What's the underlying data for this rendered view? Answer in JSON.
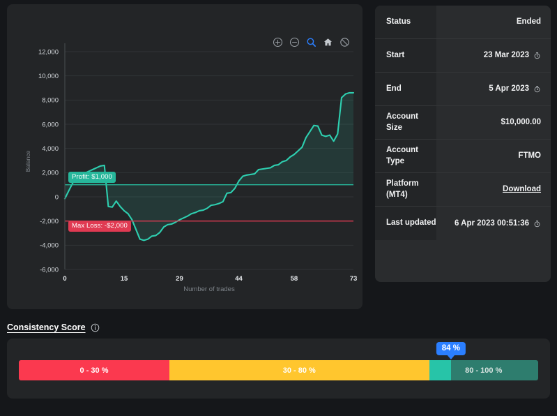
{
  "chart_data": {
    "type": "line",
    "title": "",
    "xlabel": "Number of trades",
    "ylabel": "Balance",
    "xlim": [
      0,
      73
    ],
    "ylim": [
      -6000,
      12000
    ],
    "xticks": [
      0,
      15,
      29,
      44,
      58,
      73
    ],
    "yticks": [
      -6000,
      -4000,
      -2000,
      0,
      2000,
      4000,
      6000,
      8000,
      10000,
      12000
    ],
    "ytick_labels": [
      "-6,000",
      "-4,000",
      "-2,000",
      "0",
      "2,000",
      "4,000",
      "6,000",
      "8,000",
      "10,000",
      "12,000"
    ],
    "grid": true,
    "legend": "none",
    "series": [
      {
        "name": "Balance",
        "color": "#2ecfb0",
        "fill": true,
        "x": [
          0,
          1,
          2,
          3,
          4,
          5,
          6,
          7,
          8,
          9,
          10,
          11,
          12,
          13,
          14,
          15,
          16,
          17,
          18,
          19,
          20,
          21,
          22,
          23,
          24,
          25,
          26,
          27,
          28,
          29,
          30,
          31,
          32,
          33,
          34,
          35,
          36,
          37,
          38,
          39,
          40,
          41,
          42,
          43,
          44,
          45,
          46,
          47,
          48,
          49,
          50,
          51,
          52,
          53,
          54,
          55,
          56,
          57,
          58,
          59,
          60,
          61,
          62,
          63,
          64,
          65,
          66,
          67,
          68,
          69,
          70,
          71,
          72,
          73
        ],
        "y": [
          -150,
          500,
          1150,
          1500,
          1750,
          1950,
          2100,
          2250,
          2400,
          2550,
          2600,
          -800,
          -850,
          -350,
          -800,
          -1150,
          -1400,
          -1900,
          -2700,
          -3500,
          -3600,
          -3500,
          -3250,
          -3200,
          -2950,
          -2500,
          -2300,
          -2250,
          -2100,
          -1900,
          -1750,
          -1600,
          -1400,
          -1300,
          -1150,
          -1100,
          -950,
          -700,
          -650,
          -550,
          -400,
          300,
          350,
          700,
          1300,
          1700,
          1800,
          1850,
          1900,
          2250,
          2300,
          2350,
          2400,
          2600,
          2650,
          2900,
          3000,
          3300,
          3500,
          3800,
          4100,
          4900,
          5400,
          5900,
          5850,
          5100,
          5000,
          5100,
          4600,
          5200,
          8200,
          8500,
          8600,
          8600
        ]
      }
    ],
    "reference_lines": [
      {
        "name": "profit-target",
        "value": 1000,
        "color": "#27b79b",
        "label": "Profit: $1,000"
      },
      {
        "name": "max-loss",
        "value": -2000,
        "color": "#e03a52",
        "label": "Max Loss: -$2,000"
      }
    ]
  },
  "chart_toolbar": {
    "icons": [
      {
        "name": "zoom-in-icon",
        "active": false
      },
      {
        "name": "zoom-out-icon",
        "active": false
      },
      {
        "name": "magnifier-icon",
        "active": true
      },
      {
        "name": "home-icon",
        "active": false
      },
      {
        "name": "disable-select-icon",
        "active": false
      }
    ],
    "active_color": "#2b7fff",
    "idle_color": "#9aa0a6"
  },
  "details": {
    "rows": [
      {
        "label": "Status",
        "value": "Ended",
        "icon": null,
        "link": false
      },
      {
        "label": "Start",
        "value": "23 Mar 2023",
        "icon": "stopwatch-icon",
        "link": false
      },
      {
        "label": "End",
        "value": "5 Apr 2023",
        "icon": "stopwatch-icon",
        "link": false
      },
      {
        "label": "Account Size",
        "value": "$10,000.00",
        "icon": null,
        "link": false
      },
      {
        "label": "Account Type",
        "value": "FTMO",
        "icon": null,
        "link": false
      },
      {
        "label": "Platform (MT4)",
        "value": "Download",
        "icon": null,
        "link": true
      },
      {
        "label": "Last updated",
        "value": "6 Apr 2023 00:51:36",
        "icon": "stopwatch-icon",
        "link": false
      }
    ]
  },
  "consistency": {
    "title": "Consistency Score",
    "info_icon": "info-icon",
    "score_label": "84 %",
    "score_value": 84,
    "segments": [
      {
        "label": "0 - 30 %",
        "color": "#fb394f",
        "width_pct": 29
      },
      {
        "label": "30 - 80 %",
        "color": "#ffc62e",
        "width_pct": 50
      },
      {
        "label": "80 - 100 %",
        "color": "#2e7d6e",
        "width_pct": 21
      }
    ],
    "fill_color": "#27c4a8",
    "marker_color": "#2b7fff"
  }
}
